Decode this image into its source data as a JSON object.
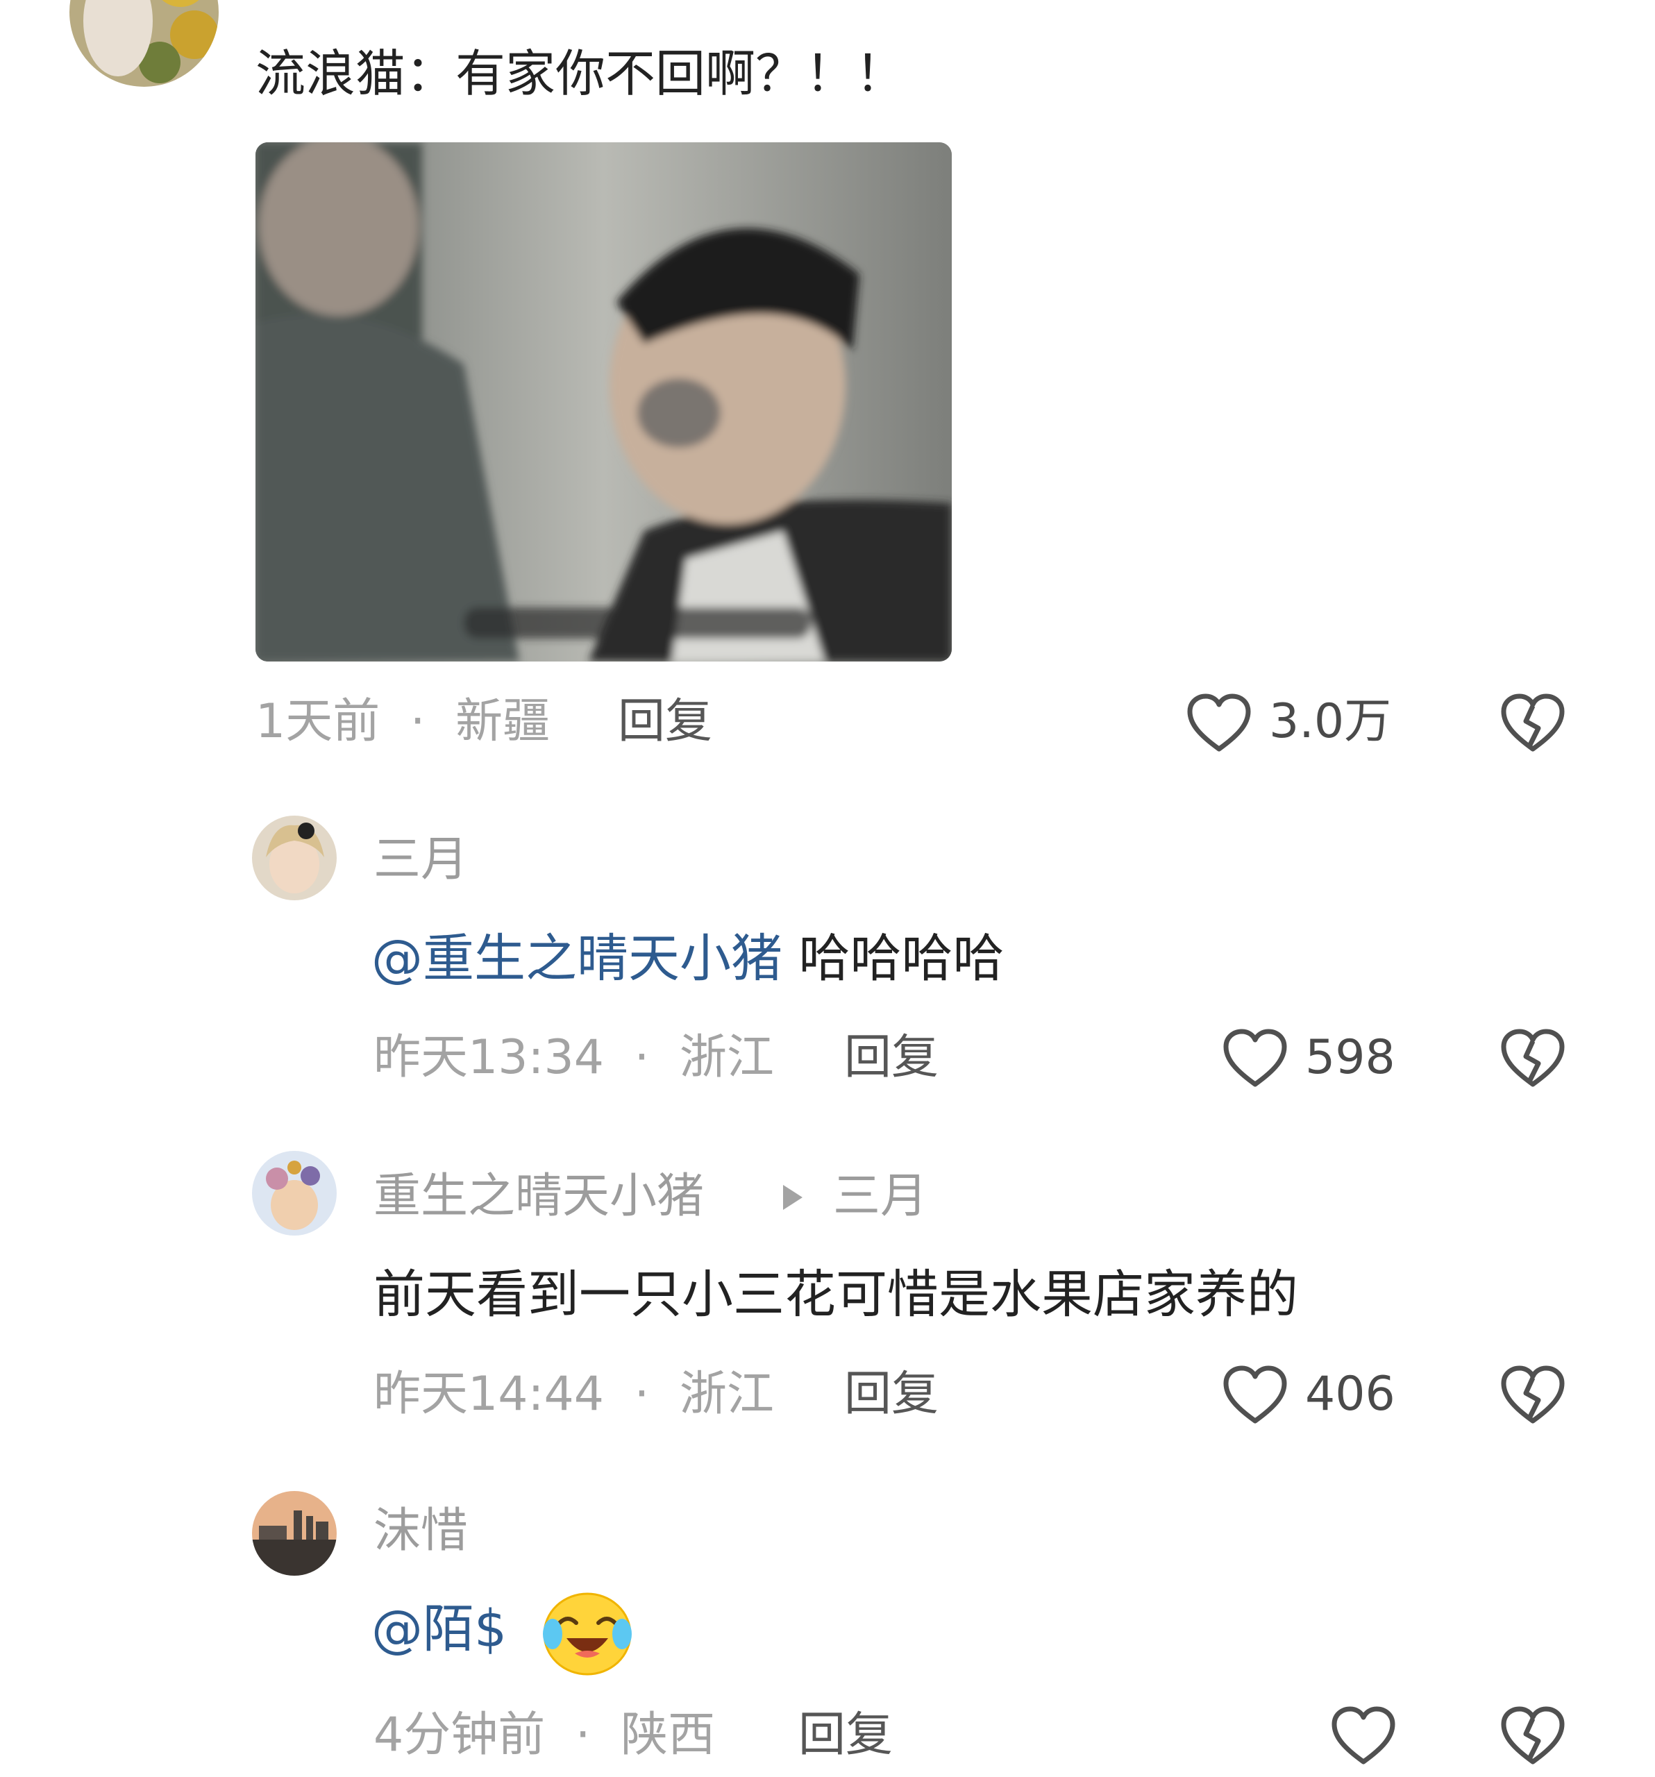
{
  "comment": {
    "text": "流浪猫：有家你不回啊？！！",
    "time": "1天前",
    "location": "新疆",
    "reply_label": "回复",
    "likes": "3.0万"
  },
  "replies": [
    {
      "username": "三月",
      "mention": "@重生之晴天小猪",
      "text": " 哈哈哈哈",
      "time": "昨天13:34",
      "location": "浙江",
      "reply_label": "回复",
      "likes": "598"
    },
    {
      "username": "重生之晴天小猪",
      "reply_to": "三月",
      "text": "前天看到一只小三花可惜是水果店家养的",
      "time": "昨天14:44",
      "location": "浙江",
      "reply_label": "回复",
      "likes": "406"
    },
    {
      "username": "沫惜",
      "mention": "@陌$",
      "emoji": "crying-laughing-emoji",
      "time": "4分钟前",
      "location": "陕西",
      "reply_label": "回复",
      "likes": ""
    }
  ],
  "separator": "·",
  "icons": {
    "like": "heart-outline-icon",
    "dislike": "broken-heart-icon",
    "reply_arrow": "play-triangle-icon"
  },
  "colors": {
    "mention": "#2e5b8f",
    "meta": "#a3a3a3",
    "text": "#222222"
  }
}
